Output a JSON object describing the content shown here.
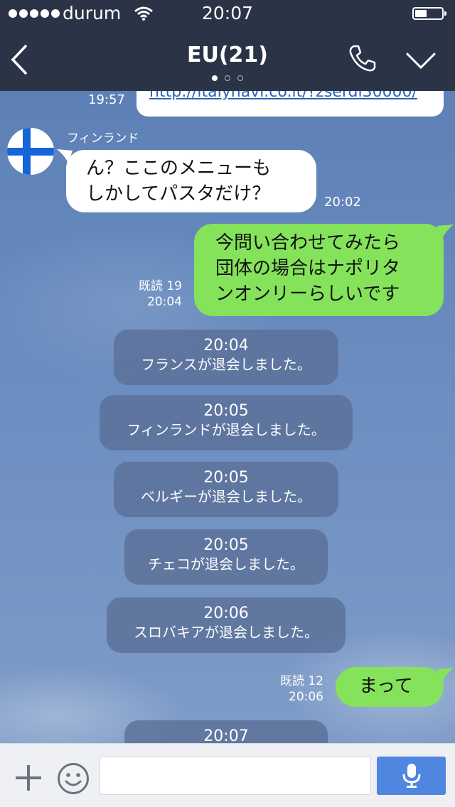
{
  "status_bar": {
    "carrier": "durum",
    "time": "20:07",
    "battery_level": 0.45
  },
  "header": {
    "title": "EU(21)",
    "page_dots": 3,
    "active_dot": 0,
    "icons": [
      "back-chevron-icon",
      "phone-icon",
      "chevron-down-icon"
    ]
  },
  "messages": {
    "link_preview": {
      "time": "19:57",
      "text": "http://italynavi.co.it/?zserdi30000/"
    },
    "incoming": {
      "sender": "フィンランド",
      "lines": [
        "ん？ここのメニューも",
        "しかしてパスタだけ？"
      ],
      "time": "20:02"
    },
    "outgoing_1": {
      "read": "既読 19",
      "time": "20:04",
      "lines": [
        "今問い合わせてみたら",
        "団体の場合はナポリタ",
        "ンオンリーらしいです"
      ]
    },
    "system": [
      {
        "time": "20:04",
        "text": "フランスが退会しました。"
      },
      {
        "time": "20:05",
        "text": "フィンランドが退会しました。"
      },
      {
        "time": "20:05",
        "text": "ベルギーが退会しました。"
      },
      {
        "time": "20:05",
        "text": "チェコが退会しました。"
      },
      {
        "time": "20:06",
        "text": "スロバキアが退会しました。"
      }
    ],
    "outgoing_2": {
      "read": "既読 12",
      "time": "20:06",
      "text": "まって"
    },
    "system_partial": {
      "time": "20:07"
    }
  },
  "input_bar": {
    "placeholder": "",
    "icons": [
      "plus-icon",
      "emoji-icon",
      "microphone-icon"
    ]
  },
  "colors": {
    "header_bg": "#2b3447",
    "outgoing_bubble": "#84e35a",
    "incoming_bubble": "#ffffff",
    "system_pill": "#5a6e96",
    "mic_button": "#4f86e0"
  }
}
